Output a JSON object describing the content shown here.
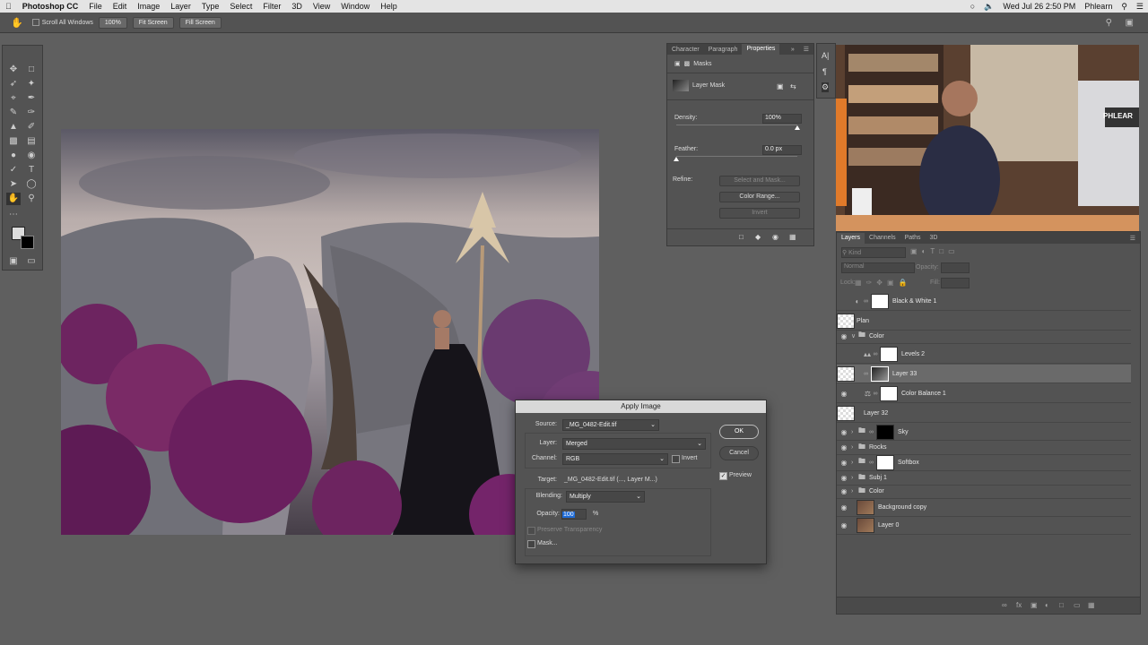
{
  "menubar": {
    "app": "Photoshop CC",
    "items": [
      "File",
      "Edit",
      "Image",
      "Layer",
      "Type",
      "Select",
      "Filter",
      "3D",
      "View",
      "Window",
      "Help"
    ],
    "datetime": "Wed Jul 26  2:50 PM",
    "user": "Phlearn"
  },
  "options_bar": {
    "scroll_all_windows": "Scroll All Windows",
    "zoom": "100%",
    "fit_screen": "Fit Screen",
    "fill_screen": "Fill Screen"
  },
  "properties_panel": {
    "tabs": [
      "Character",
      "Paragraph",
      "Properties"
    ],
    "section": "Masks",
    "mask_type": "Layer Mask",
    "density_label": "Density:",
    "density_value": "100%",
    "density_fraction": 1.0,
    "feather_label": "Feather:",
    "feather_value": "0.0 px",
    "feather_fraction": 0.0,
    "refine_label": "Refine:",
    "select_and_mask": "Select and Mask...",
    "color_range": "Color Range...",
    "invert": "Invert"
  },
  "layers_panel": {
    "tabs": [
      "Layers",
      "Channels",
      "Paths",
      "3D"
    ],
    "filter_kind": "Kind",
    "blend_mode": "Normal",
    "opacity_label": "Opacity:",
    "lock_label": "Lock:",
    "fill_label": "Fill:",
    "layers": [
      {
        "name": "Black & White 1",
        "visible": false,
        "thumb": "adjust",
        "mask": true,
        "indent": 0
      },
      {
        "name": "Plan",
        "visible": false,
        "thumb": "chk",
        "mask": false,
        "indent": 0
      },
      {
        "name": "Color",
        "visible": true,
        "thumb": "folder",
        "mask": false,
        "indent": 0
      },
      {
        "name": "Levels 2",
        "visible": false,
        "thumb": "levels",
        "mask": true,
        "indent": 1
      },
      {
        "name": "Layer 33",
        "visible": true,
        "thumb": "chk",
        "mask": true,
        "indent": 1,
        "selected": true
      },
      {
        "name": "Color Balance 1",
        "visible": true,
        "thumb": "balance",
        "mask": true,
        "indent": 1
      },
      {
        "name": "Layer 32",
        "visible": true,
        "thumb": "chk",
        "mask": false,
        "indent": 1
      },
      {
        "name": "Sky",
        "visible": true,
        "thumb": "folder",
        "mask": true,
        "indent": 0
      },
      {
        "name": "Rocks",
        "visible": true,
        "thumb": "folder",
        "mask": false,
        "indent": 0
      },
      {
        "name": "Softbox",
        "visible": true,
        "thumb": "folder",
        "mask": true,
        "indent": 0
      },
      {
        "name": "Subj 1",
        "visible": true,
        "thumb": "folder",
        "mask": false,
        "indent": 0
      },
      {
        "name": "Color",
        "visible": true,
        "thumb": "folder",
        "mask": false,
        "indent": 0
      },
      {
        "name": "Background copy",
        "visible": true,
        "thumb": "photo",
        "mask": false,
        "indent": 0
      },
      {
        "name": "Layer 0",
        "visible": true,
        "thumb": "photo",
        "mask": false,
        "indent": 0
      }
    ]
  },
  "dialog": {
    "title": "Apply Image",
    "source_label": "Source:",
    "source_value": "_MG_0482-Edit.tif",
    "layer_label": "Layer:",
    "layer_value": "Merged",
    "channel_label": "Channel:",
    "channel_value": "RGB",
    "invert_label": "Invert",
    "target_label": "Target:",
    "target_value": "_MG_0482-Edit.tif (..., Layer M...)",
    "blending_label": "Blending:",
    "blending_value": "Multiply",
    "opacity_label": "Opacity:",
    "opacity_value": "100",
    "opacity_unit": "%",
    "preserve_transparency": "Preserve Transparency",
    "mask_label": "Mask...",
    "ok": "OK",
    "cancel": "Cancel",
    "preview": "Preview"
  },
  "webcam_sign": "PHLEAR",
  "colors": {
    "selection_blue": "#1e6bd6",
    "panel_bg": "#535353",
    "workspace_bg": "#5f5f5f",
    "flower_purple": "#7a2a66"
  }
}
